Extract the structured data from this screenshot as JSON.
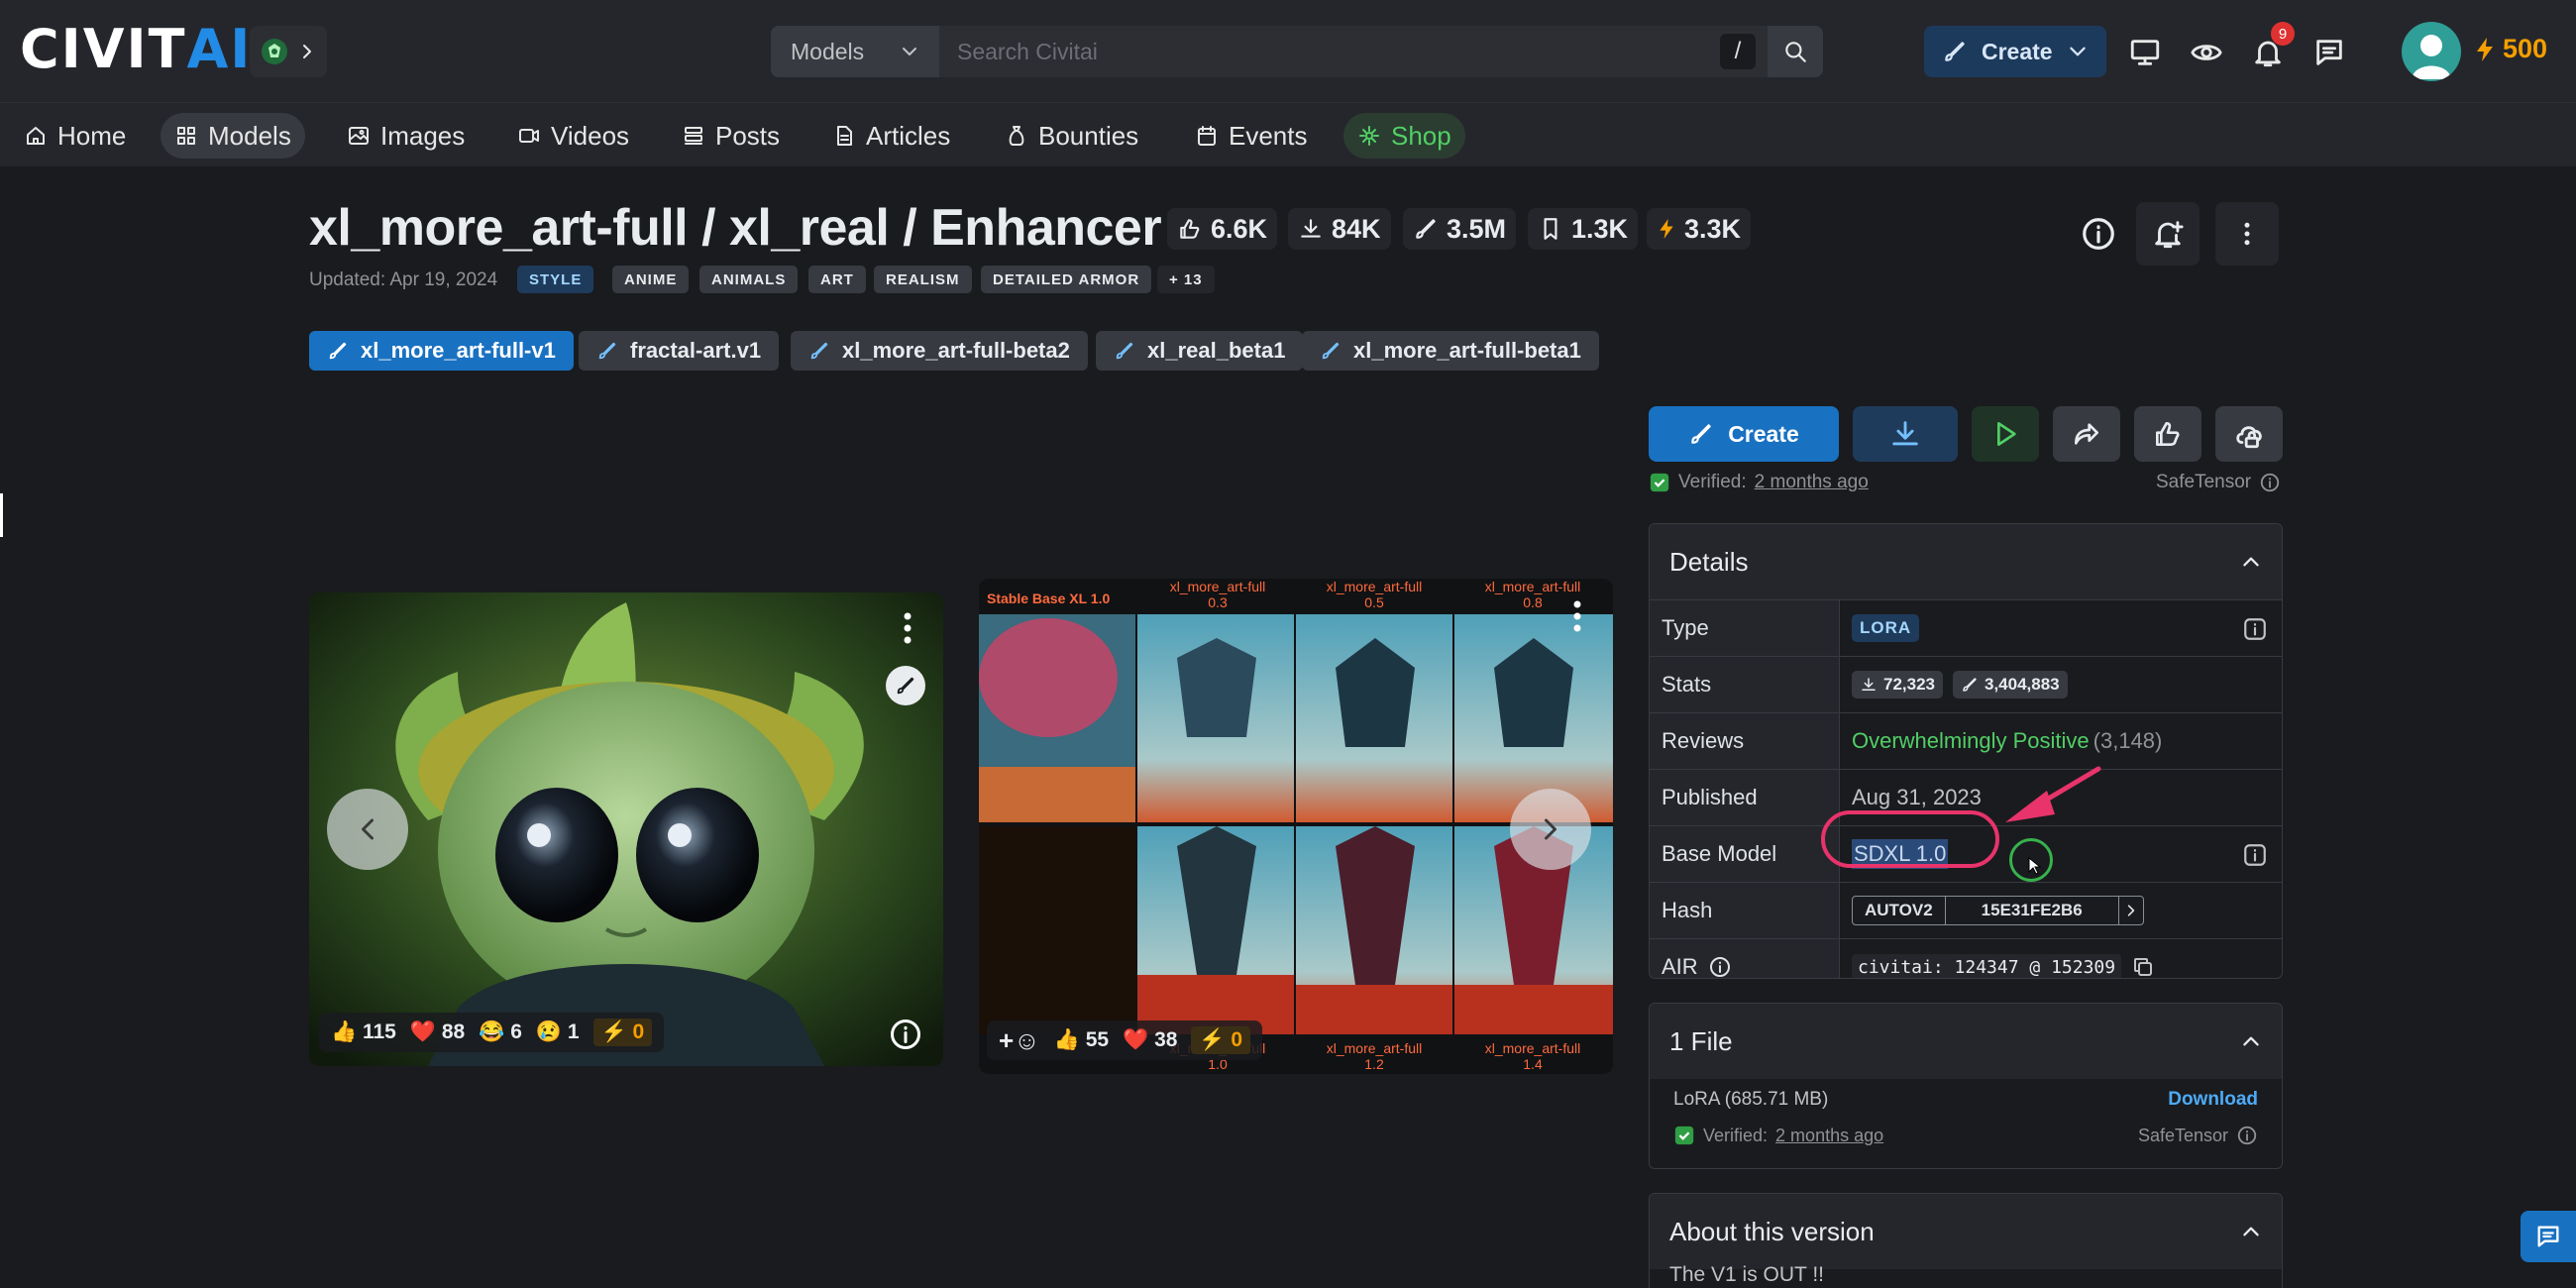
{
  "header": {
    "logo_part1": "CIVIT",
    "logo_part2": "AI",
    "search_type": "Models",
    "search_placeholder": "Search Civitai",
    "search_shortcut": "/",
    "create_label": "Create",
    "notification_count": "9",
    "buzz_amount": "500"
  },
  "nav": {
    "items": [
      {
        "label": "Home",
        "icon": "home-icon"
      },
      {
        "label": "Models",
        "icon": "grid-icon"
      },
      {
        "label": "Images",
        "icon": "image-icon"
      },
      {
        "label": "Videos",
        "icon": "video-icon"
      },
      {
        "label": "Posts",
        "icon": "posts-icon"
      },
      {
        "label": "Articles",
        "icon": "file-icon"
      },
      {
        "label": "Bounties",
        "icon": "moneybag-icon"
      },
      {
        "label": "Events",
        "icon": "calendar-icon"
      },
      {
        "label": "Shop",
        "icon": "shop-icon"
      }
    ],
    "active": "Models"
  },
  "model": {
    "title": "xl_more_art-full / xl_real / Enhancer",
    "stats": {
      "likes": "6.6K",
      "downloads": "84K",
      "generations": "3.5M",
      "bookmarks": "1.3K",
      "buzz": "3.3K"
    },
    "updated": "Updated: Apr 19, 2024",
    "tags": [
      "STYLE",
      "ANIME",
      "ANIMALS",
      "ART",
      "REALISM",
      "DETAILED ARMOR",
      "+ 13"
    ],
    "versions": [
      "xl_more_art-full-v1",
      "fractal-art.v1",
      "xl_more_art-full-beta2",
      "xl_real_beta1",
      "xl_more_art-full-beta1"
    ]
  },
  "gallery": {
    "image1": {
      "reactions": {
        "like": "115",
        "heart": "88",
        "laugh": "6",
        "cry": "1",
        "buzz": "0"
      }
    },
    "image2": {
      "reactions": {
        "like": "55",
        "heart": "38",
        "buzz": "0"
      },
      "grid_header": [
        "Stable Base XL 1.0",
        "xl_more_art-full",
        "xl_more_art-full",
        "xl_more_art-full"
      ],
      "grid_header_values": [
        "",
        "0.3",
        "0.5",
        "0.8"
      ],
      "grid_footer": [
        "xl_more_art-full",
        "xl_more_art-full",
        "xl_more_art-full"
      ],
      "grid_footer_values": [
        "1.0",
        "1.2",
        "1.4"
      ]
    }
  },
  "actions": {
    "create_label": "Create",
    "verified_label": "Verified:",
    "verified_time": "2 months ago",
    "safetensor_label": "SafeTensor"
  },
  "details": {
    "title": "Details",
    "rows": {
      "type_label": "Type",
      "type_value": "LORA",
      "stats_label": "Stats",
      "stats_downloads": "72,323",
      "stats_generations": "3,404,883",
      "reviews_label": "Reviews",
      "reviews_value": "Overwhelmingly Positive",
      "reviews_count": "(3,148)",
      "published_label": "Published",
      "published_value": "Aug 31, 2023",
      "base_model_label": "Base Model",
      "base_model_value": "SDXL 1.0",
      "hash_label": "Hash",
      "hash_type": "AUTOV2",
      "hash_value": "15E31FE2B6",
      "air_label": "AIR",
      "air_value": "civitai: 124347 @ 152309"
    }
  },
  "files": {
    "title": "1 File",
    "file_name": "LoRA (685.71 MB)",
    "download_label": "Download",
    "verified_label": "Verified:",
    "verified_time": "2 months ago",
    "safetensor_label": "SafeTensor"
  },
  "about": {
    "title": "About this version",
    "snippet": "The V1 is OUT !!"
  },
  "colors": {
    "accent": "#1971c2",
    "positive": "#51cf66",
    "buzz": "#f59f00",
    "highlight": "#e8336b"
  }
}
